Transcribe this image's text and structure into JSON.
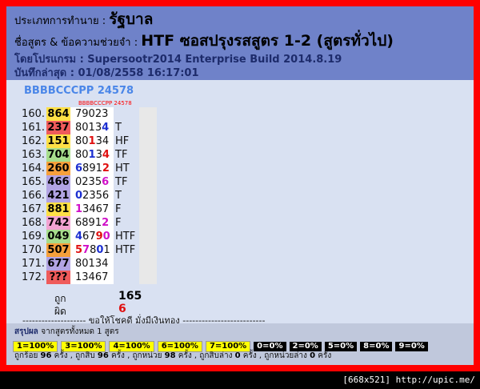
{
  "header": {
    "line1_label": "ประเภทการทำนาย :",
    "line1_value": "รัฐบาล",
    "line2_label": "ชื่อสูตร & ข้อความช่วยจำ :",
    "line2_value": "HTF ซอสปรุงรสสูตร 1-2 (สูตรทั่วไป)",
    "line3": "โดยโปรแกรม : Supersootr2014 Enterprise Build 2014.8.19",
    "line4": "บันทึกล่าสุด : 01/08/2558 16:17:01"
  },
  "pattern_title": "BBBBCCCPP 24578",
  "pattern_small": "BBBBCCCPP 24578",
  "rows": [
    {
      "n": "160.",
      "r": "864",
      "c": "c-yellow",
      "d": [
        [
          "79023",
          ""
        ]
      ],
      "t": ""
    },
    {
      "n": "161.",
      "r": "237",
      "c": "c-red",
      "d": [
        [
          "8013",
          ""
        ],
        [
          "4",
          "b-blue"
        ]
      ],
      "t": "T"
    },
    {
      "n": "162.",
      "r": "151",
      "c": "c-yellow",
      "d": [
        [
          "80",
          ""
        ],
        [
          "1",
          "b-red"
        ],
        [
          "34",
          ""
        ]
      ],
      "t": "HF"
    },
    {
      "n": "163.",
      "r": "704",
      "c": "c-green",
      "d": [
        [
          "80",
          ""
        ],
        [
          "1",
          "b-blue"
        ],
        [
          "3",
          ""
        ],
        [
          "4",
          "b-red"
        ]
      ],
      "t": "TF"
    },
    {
      "n": "164.",
      "r": "260",
      "c": "c-orange",
      "d": [
        [
          "6",
          "b-blue"
        ],
        [
          "891",
          ""
        ],
        [
          "2",
          "b-red"
        ]
      ],
      "t": "HT"
    },
    {
      "n": "165.",
      "r": "466",
      "c": "c-lilac",
      "d": [
        [
          "0235",
          ""
        ],
        [
          "6",
          "b-mag"
        ]
      ],
      "t": "TF"
    },
    {
      "n": "166.",
      "r": "421",
      "c": "c-lilac",
      "d": [
        [
          "0",
          "b-blue"
        ],
        [
          "2356",
          ""
        ]
      ],
      "t": "T"
    },
    {
      "n": "167.",
      "r": "881",
      "c": "c-yellow",
      "d": [
        [
          "1",
          "b-mag"
        ],
        [
          "3467",
          ""
        ]
      ],
      "t": "F"
    },
    {
      "n": "168.",
      "r": "742",
      "c": "c-pink",
      "d": [
        [
          "6891",
          ""
        ],
        [
          "2",
          "b-mag"
        ]
      ],
      "t": "F"
    },
    {
      "n": "169.",
      "r": "049",
      "c": "c-green",
      "d": [
        [
          "4",
          "b-blue"
        ],
        [
          "67",
          ""
        ],
        [
          "9",
          "b-red"
        ],
        [
          "0",
          "b-mag"
        ]
      ],
      "t": "HTF"
    },
    {
      "n": "170.",
      "r": "507",
      "c": "c-orange",
      "d": [
        [
          "5",
          "b-red"
        ],
        [
          "7",
          "b-mag"
        ],
        [
          "8",
          ""
        ],
        [
          "0",
          "b-blue"
        ],
        [
          "1",
          ""
        ]
      ],
      "t": "HTF"
    },
    {
      "n": "171.",
      "r": "677",
      "c": "c-lilac",
      "d": [
        [
          "80134",
          ""
        ]
      ],
      "t": ""
    },
    {
      "n": "172.",
      "r": "???",
      "c": "c-red",
      "d": [
        [
          "13467",
          ""
        ]
      ],
      "t": ""
    }
  ],
  "stats": {
    "correct_label": "ถูก",
    "correct_value": "165",
    "wrong_label": "ผิด",
    "wrong_value": "6"
  },
  "motto": "-------------------- ขอให้โชคดี มั่งมีเงินทอง --------------------------",
  "summary": {
    "title": "สรุปผล",
    "title_note": "จากสูตรทั้งหมด 1 สูตร",
    "yellow_badges": [
      "1=100%",
      "3=100%",
      "4=100%",
      "6=100%",
      "7=100%"
    ],
    "black_badges": [
      "0=0%",
      "2=0%",
      "5=0%",
      "8=0%",
      "9=0%"
    ],
    "foot": [
      {
        "t": "ถูกร้อย ",
        "b": "96",
        "e": " ครั้ง , "
      },
      {
        "t": "ถูกสิบ ",
        "b": "96",
        "e": " ครั้ง , "
      },
      {
        "t": "ถูกหน่วย ",
        "b": "98",
        "e": " ครั้ง , "
      },
      {
        "t": "ถูกสิบล่าง ",
        "b": "0",
        "e": " ครั้ง , ",
        "z": true
      },
      {
        "t": "ถูกหน่วยล่าง ",
        "b": "0",
        "e": " ครั้ง",
        "z": true
      }
    ]
  },
  "watermark": "[668x521] http://upic.me/",
  "colors": {
    "frame": "#ff0000",
    "header_bg": "#6f82c9",
    "body_bg": "#d9e1f2",
    "accent_blue": "#1c2fd1",
    "accent_red": "#e01010",
    "accent_magenta": "#d010c8"
  }
}
